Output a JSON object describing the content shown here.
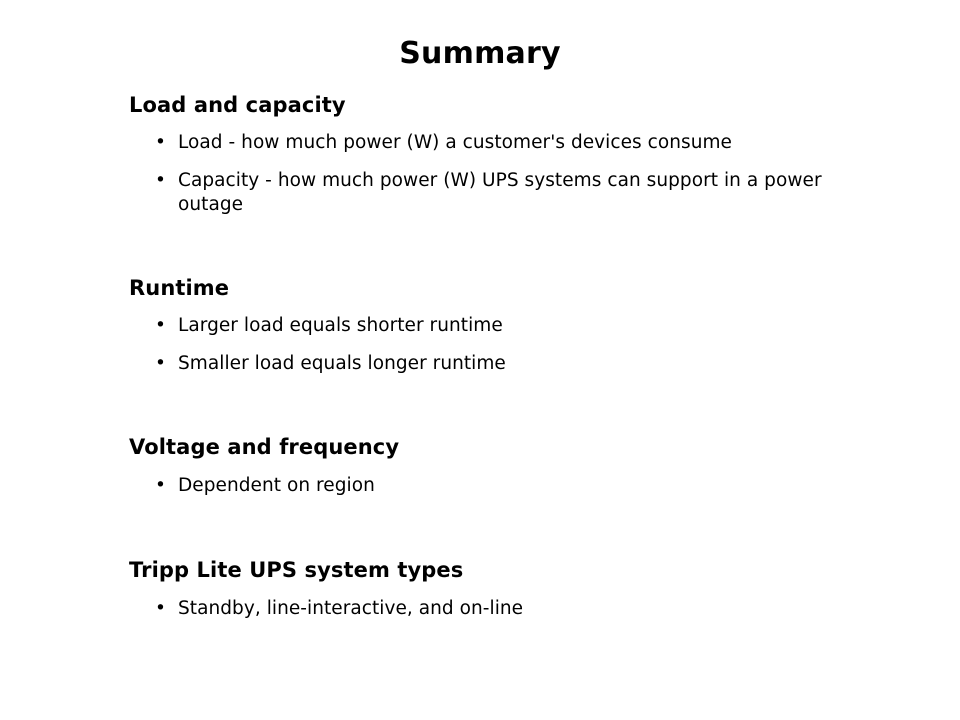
{
  "slide": {
    "title": "Summary",
    "background_color": "#ffffff",
    "text_color": "#000000",
    "bullet_glyph": "•",
    "sections": [
      {
        "heading": "Load and capacity",
        "bullets": [
          "Load - how much power (W) a customer's devices consume",
          "Capacity - how much power (W) UPS systems can support in a power outage"
        ]
      },
      {
        "heading": "Runtime",
        "bullets": [
          "Larger load equals shorter runtime",
          "Smaller load equals longer runtime"
        ]
      },
      {
        "heading": "Voltage and frequency",
        "bullets": [
          "Dependent on region"
        ]
      },
      {
        "heading": "Tripp Lite UPS system types",
        "bullets": [
          "Standby, line-interactive, and on-line"
        ]
      }
    ]
  }
}
